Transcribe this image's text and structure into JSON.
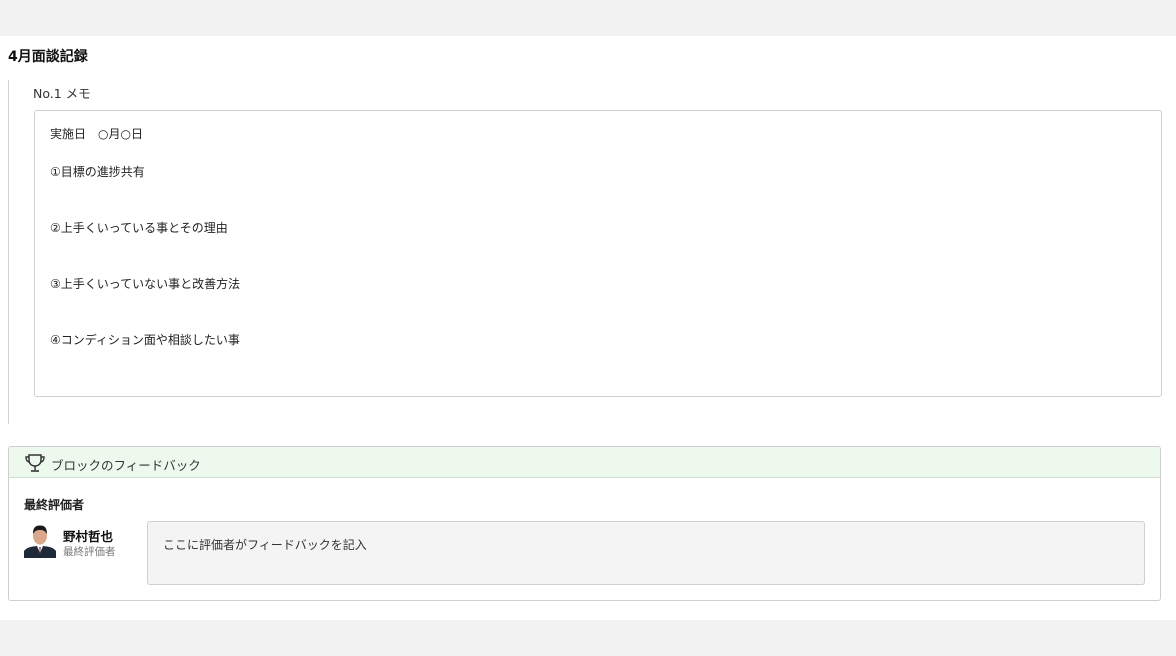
{
  "section": {
    "title": "4月面談記録"
  },
  "memo": {
    "label": "No.1  メモ",
    "lines": [
      "実施日　○月○日",
      "①目標の進捗共有",
      "②上手くいっている事とその理由",
      "③上手くいっていない事と改善方法",
      "④コンディション面や相談したい事"
    ]
  },
  "feedback": {
    "header_icon": "trophy-icon",
    "header_title": "ブロックのフィードバック",
    "evaluator_label": "最終評価者",
    "evaluator": {
      "name": "野村哲也",
      "role": "最終評価者"
    },
    "text": "ここに評価者がフィードバックを記入"
  },
  "colors": {
    "page_bg": "#f2f2f2",
    "panel_header_bg": "#ecf9ec",
    "textbox_bg": "#f4f4f4"
  }
}
